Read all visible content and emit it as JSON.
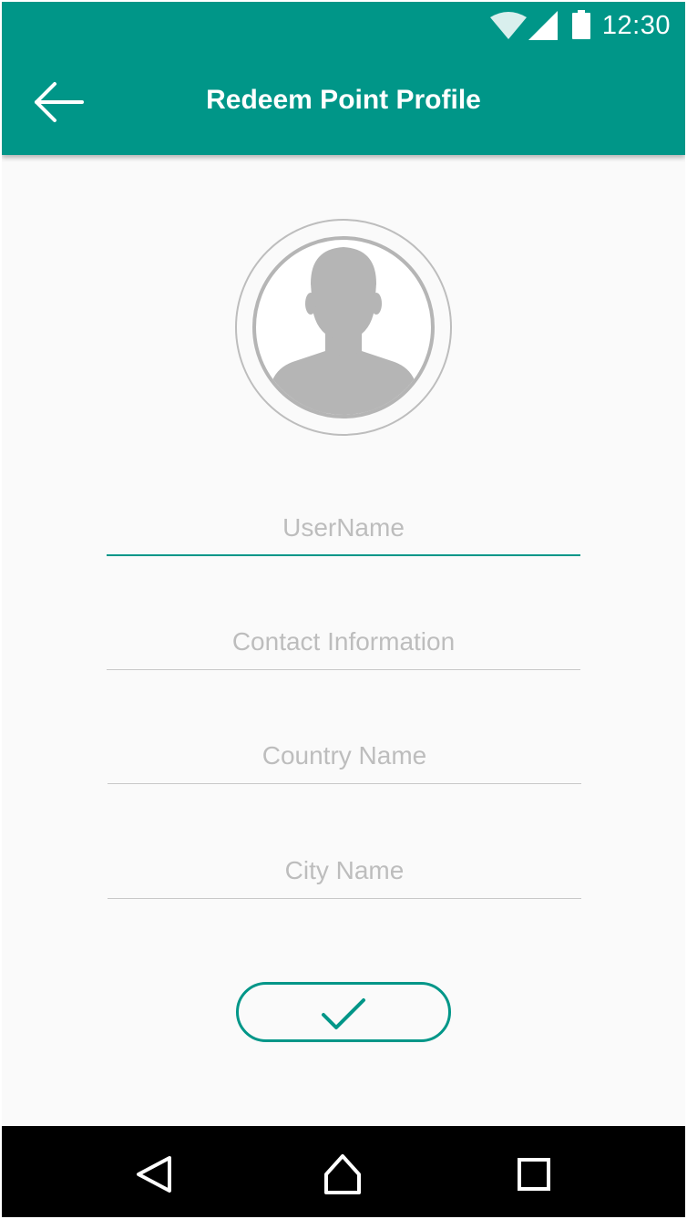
{
  "status_bar": {
    "time": "12:30",
    "icons": [
      "wifi-icon",
      "signal-icon",
      "battery-icon"
    ]
  },
  "appbar": {
    "title": "Redeem Point Profile",
    "back_icon": "arrow-left-icon"
  },
  "avatar": {
    "icon": "person-silhouette-icon"
  },
  "form": {
    "username": {
      "placeholder": "UserName",
      "value": ""
    },
    "contact": {
      "placeholder": "Contact Information",
      "value": ""
    },
    "country": {
      "placeholder": "Country Name",
      "value": ""
    },
    "city": {
      "placeholder": "City Name",
      "value": ""
    },
    "submit_icon": "checkmark-icon"
  },
  "nav_bar": {
    "buttons": [
      "back-triangle-icon",
      "home-icon",
      "recents-square-icon"
    ]
  },
  "colors": {
    "primary": "#009688",
    "background": "#fafafa",
    "placeholder": "#bdbdbd",
    "divider": "#c8c8c8",
    "avatar_gray": "#b5b5b5"
  }
}
